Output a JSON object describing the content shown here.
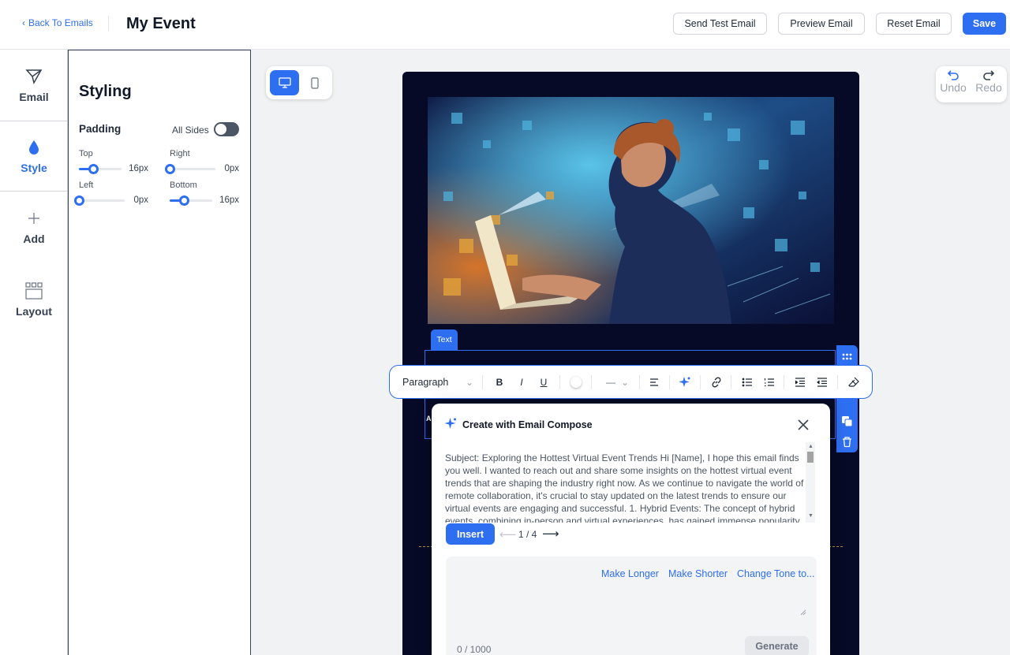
{
  "header": {
    "back_label": "Back To Emails",
    "title": "My Event",
    "buttons": {
      "send_test": "Send Test Email",
      "preview": "Preview Email",
      "reset": "Reset Email",
      "save": "Save"
    }
  },
  "rail": {
    "items": [
      {
        "label": "Email",
        "icon": "send-icon"
      },
      {
        "label": "Style",
        "icon": "droplet-icon",
        "active": true
      },
      {
        "label": "Add",
        "icon": "plus-icon"
      },
      {
        "label": "Layout",
        "icon": "layout-icon"
      }
    ]
  },
  "styling": {
    "title": "Styling",
    "padding_label": "Padding",
    "all_sides_label": "All Sides",
    "all_sides_on": false,
    "sliders": [
      {
        "label": "Top",
        "value": "16px",
        "fraction": 0.33
      },
      {
        "label": "Right",
        "value": "0px",
        "fraction": 0.0
      },
      {
        "label": "Left",
        "value": "0px",
        "fraction": 0.0
      },
      {
        "label": "Bottom",
        "value": "16px",
        "fraction": 0.33
      }
    ]
  },
  "undo_redo": {
    "undo": "Undo",
    "redo": "Redo"
  },
  "canvas": {
    "block_tag": "Text",
    "ghost_char": "A"
  },
  "toolbar": {
    "block_type": "Paragraph"
  },
  "compose": {
    "title": "Create with Email Compose",
    "text": "Subject: Exploring the Hottest Virtual Event Trends Hi [Name], I hope this email finds you well. I wanted to reach out and share some insights on the hottest virtual event trends that are shaping the industry right now. As we continue to navigate the world of remote collaboration, it's crucial to stay updated on the latest trends to ensure our virtual events are engaging and successful. 1. Hybrid Events: The concept of hybrid events, combining in-person and virtual experiences, has gained immense popularity",
    "insert_label": "Insert",
    "pager": "1 / 4",
    "chips": [
      "Make Longer",
      "Make Shorter",
      "Change Tone to..."
    ],
    "char_count": "0 / 1000",
    "generate_label": "Generate"
  },
  "colors": {
    "accent": "#2e6ef0",
    "canvas_bg": "#060a26"
  }
}
